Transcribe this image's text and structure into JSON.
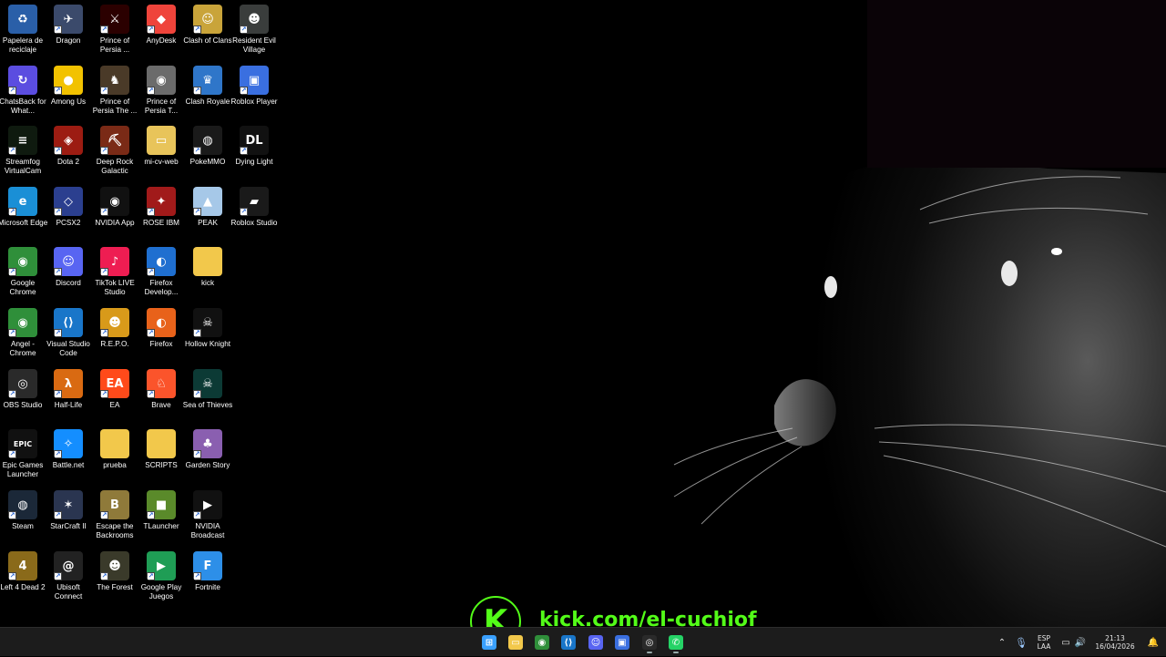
{
  "desktop": {
    "icons": [
      {
        "label": "Papelera de reciclaje",
        "icon": "recycle-bin-icon",
        "color": "#2a5fa8",
        "glyph": "♻",
        "shortcut": false
      },
      {
        "label": "Dragon",
        "icon": "dragon-icon",
        "color": "#3b4a6b",
        "glyph": "✈",
        "shortcut": true
      },
      {
        "label": "Prince of Persia ...",
        "icon": "prince-of-persia-icon",
        "color": "#2b0000",
        "glyph": "⚔",
        "shortcut": true
      },
      {
        "label": "AnyDesk",
        "icon": "anydesk-icon",
        "color": "#ef443b",
        "glyph": "◆",
        "shortcut": true
      },
      {
        "label": "Clash of Clans",
        "icon": "clash-of-clans-icon",
        "color": "#c9a43a",
        "glyph": "☺",
        "shortcut": true
      },
      {
        "label": "Resident Evil Village",
        "icon": "resident-evil-village-icon",
        "color": "#3a3d3c",
        "glyph": "☻",
        "shortcut": true
      },
      {
        "label": "ChatsBack for What...",
        "icon": "chatsback-icon",
        "color": "#5b4de0",
        "glyph": "↻",
        "shortcut": true
      },
      {
        "label": "Among Us",
        "icon": "among-us-icon",
        "color": "#f2c200",
        "glyph": "●",
        "shortcut": true
      },
      {
        "label": "Prince of Persia The ...",
        "icon": "prince-of-persia-sands-icon",
        "color": "#4a3a28",
        "glyph": "♞",
        "shortcut": true
      },
      {
        "label": "Prince of Persia T...",
        "icon": "prince-of-persia-t-icon",
        "color": "#6b6b6b",
        "glyph": "◉",
        "shortcut": true
      },
      {
        "label": "Clash Royale",
        "icon": "clash-royale-icon",
        "color": "#2f76c9",
        "glyph": "♛",
        "shortcut": true
      },
      {
        "label": "Roblox Player",
        "icon": "roblox-player-icon",
        "color": "#3a6fe0",
        "glyph": "▣",
        "shortcut": true
      },
      {
        "label": "Streamfog VirtualCam",
        "icon": "streamfog-icon",
        "color": "#0f1a0f",
        "glyph": "≡",
        "shortcut": true
      },
      {
        "label": "Dota 2",
        "icon": "dota2-icon",
        "color": "#9c1c12",
        "glyph": "◈",
        "shortcut": true
      },
      {
        "label": "Deep Rock Galactic",
        "icon": "deep-rock-galactic-icon",
        "color": "#7a2a16",
        "glyph": "⛏",
        "shortcut": true
      },
      {
        "label": "mi-cv-web",
        "icon": "folder-icon",
        "color": "#e8c45a",
        "glyph": "▭",
        "shortcut": false
      },
      {
        "label": "PokeMMO",
        "icon": "pokemmo-icon",
        "color": "#1a1a1a",
        "glyph": "◍",
        "shortcut": true
      },
      {
        "label": "Dying Light",
        "icon": "dying-light-icon",
        "color": "#111111",
        "glyph": "DL",
        "shortcut": true
      },
      {
        "label": "Microsoft Edge",
        "icon": "edge-icon",
        "color": "#1a8fd6",
        "glyph": "e",
        "shortcut": true
      },
      {
        "label": "PCSX2",
        "icon": "pcsx2-icon",
        "color": "#2b3f8f",
        "glyph": "◇",
        "shortcut": true
      },
      {
        "label": "NVIDIA App",
        "icon": "nvidia-app-icon",
        "color": "#111111",
        "glyph": "◉",
        "shortcut": true
      },
      {
        "label": "ROSE IBM",
        "icon": "rose-ibm-icon",
        "color": "#a11a1a",
        "glyph": "✦",
        "shortcut": true
      },
      {
        "label": "PEAK",
        "icon": "peak-icon",
        "color": "#a6c8e8",
        "glyph": "▲",
        "shortcut": true
      },
      {
        "label": "Roblox Studio",
        "icon": "roblox-studio-icon",
        "color": "#1a1a1a",
        "glyph": "▰",
        "shortcut": true
      },
      {
        "label": "Google Chrome",
        "icon": "chrome-icon",
        "color": "#2f8f3a",
        "glyph": "◉",
        "shortcut": true
      },
      {
        "label": "Discord",
        "icon": "discord-icon",
        "color": "#5865f2",
        "glyph": "☺",
        "shortcut": true
      },
      {
        "label": "TikTok LIVE Studio",
        "icon": "tiktok-live-icon",
        "color": "#ee1d52",
        "glyph": "♪",
        "shortcut": true
      },
      {
        "label": "Firefox Develop...",
        "icon": "firefox-developer-icon",
        "color": "#1f6fd0",
        "glyph": "◐",
        "shortcut": true
      },
      {
        "label": "kick",
        "icon": "folder-icon",
        "color": "#f2c84b",
        "glyph": "",
        "shortcut": false
      },
      {
        "label": "",
        "icon": "",
        "color": "",
        "glyph": "",
        "shortcut": false
      },
      {
        "label": "Angel - Chrome",
        "icon": "angel-chrome-icon",
        "color": "#2f8f3a",
        "glyph": "◉",
        "shortcut": true
      },
      {
        "label": "Visual Studio Code",
        "icon": "vscode-icon",
        "color": "#1976c9",
        "glyph": "⟨⟩",
        "shortcut": true
      },
      {
        "label": "R.E.P.O.",
        "icon": "repo-icon",
        "color": "#d89a1a",
        "glyph": "☻",
        "shortcut": true
      },
      {
        "label": "Firefox",
        "icon": "firefox-icon",
        "color": "#e8621a",
        "glyph": "◐",
        "shortcut": true
      },
      {
        "label": "Hollow Knight",
        "icon": "hollow-knight-icon",
        "color": "#111111",
        "glyph": "☠",
        "shortcut": true
      },
      {
        "label": "",
        "icon": "",
        "color": "",
        "glyph": "",
        "shortcut": false
      },
      {
        "label": "OBS Studio",
        "icon": "obs-studio-icon",
        "color": "#2a2a2a",
        "glyph": "◎",
        "shortcut": true
      },
      {
        "label": "Half-Life",
        "icon": "half-life-icon",
        "color": "#d96a12",
        "glyph": "λ",
        "shortcut": true
      },
      {
        "label": "EA",
        "icon": "ea-icon",
        "color": "#ff4a1a",
        "glyph": "EA",
        "shortcut": true
      },
      {
        "label": "Brave",
        "icon": "brave-icon",
        "color": "#fb542b",
        "glyph": "♘",
        "shortcut": true
      },
      {
        "label": "Sea of Thieves",
        "icon": "sea-of-thieves-icon",
        "color": "#0c3a35",
        "glyph": "☠",
        "shortcut": true
      },
      {
        "label": "",
        "icon": "",
        "color": "",
        "glyph": "",
        "shortcut": false
      },
      {
        "label": "Epic Games Launcher",
        "icon": "epic-games-icon",
        "color": "#111111",
        "glyph": "EPIC",
        "shortcut": true
      },
      {
        "label": "Battle.net",
        "icon": "battlenet-icon",
        "color": "#148eff",
        "glyph": "✧",
        "shortcut": true
      },
      {
        "label": "prueba",
        "icon": "folder-icon",
        "color": "#f2c84b",
        "glyph": "",
        "shortcut": false
      },
      {
        "label": "SCRIPTS",
        "icon": "folder-icon",
        "color": "#f2c84b",
        "glyph": "",
        "shortcut": false
      },
      {
        "label": "Garden Story",
        "icon": "garden-story-icon",
        "color": "#8a5fb0",
        "glyph": "♣",
        "shortcut": true
      },
      {
        "label": "",
        "icon": "",
        "color": "",
        "glyph": "",
        "shortcut": false
      },
      {
        "label": "Steam",
        "icon": "steam-icon",
        "color": "#1b2838",
        "glyph": "◍",
        "shortcut": true
      },
      {
        "label": "StarCraft II",
        "icon": "starcraft2-icon",
        "color": "#2a3550",
        "glyph": "✶",
        "shortcut": true
      },
      {
        "label": "Escape the Backrooms",
        "icon": "escape-backrooms-icon",
        "color": "#8f7a3a",
        "glyph": "B",
        "shortcut": true
      },
      {
        "label": "TLauncher",
        "icon": "tlauncher-icon",
        "color": "#5a8a2a",
        "glyph": "■",
        "shortcut": true
      },
      {
        "label": "NVIDIA Broadcast",
        "icon": "nvidia-broadcast-icon",
        "color": "#111111",
        "glyph": "▶",
        "shortcut": true
      },
      {
        "label": "",
        "icon": "",
        "color": "",
        "glyph": "",
        "shortcut": false
      },
      {
        "label": "Left 4 Dead 2",
        "icon": "left4dead2-icon",
        "color": "#8a6a1a",
        "glyph": "4",
        "shortcut": true
      },
      {
        "label": "Ubisoft Connect",
        "icon": "ubisoft-connect-icon",
        "color": "#222222",
        "glyph": "@",
        "shortcut": true
      },
      {
        "label": "The Forest",
        "icon": "the-forest-icon",
        "color": "#3a3a2a",
        "glyph": "☻",
        "shortcut": true
      },
      {
        "label": "Google Play Juegos",
        "icon": "google-play-games-icon",
        "color": "#1f9d55",
        "glyph": "▶",
        "shortcut": true
      },
      {
        "label": "Fortnite",
        "icon": "fortnite-icon",
        "color": "#2d8fe8",
        "glyph": "F",
        "shortcut": true
      }
    ]
  },
  "overlay": {
    "kick_letter": "K",
    "kick_url": "kick.com/el-cuchiof",
    "accent": "#53fc18"
  },
  "taskbar": {
    "apps": [
      {
        "name": "start-button",
        "icon": "windows-start-icon",
        "color": "#3aa0ff",
        "glyph": "⊞"
      },
      {
        "name": "file-explorer",
        "icon": "file-explorer-icon",
        "color": "#f2c84b",
        "glyph": "▭"
      },
      {
        "name": "chrome",
        "icon": "chrome-icon",
        "color": "#2f8f3a",
        "glyph": "◉"
      },
      {
        "name": "vscode",
        "icon": "vscode-icon",
        "color": "#1976c9",
        "glyph": "⟨⟩"
      },
      {
        "name": "discord",
        "icon": "discord-icon",
        "color": "#5865f2",
        "glyph": "☺"
      },
      {
        "name": "roblox",
        "icon": "roblox-icon",
        "color": "#3a6fe0",
        "glyph": "▣"
      },
      {
        "name": "obs",
        "icon": "obs-studio-icon",
        "color": "#2a2a2a",
        "glyph": "◎"
      },
      {
        "name": "whatsapp",
        "icon": "whatsapp-icon",
        "color": "#25d366",
        "glyph": "✆"
      }
    ],
    "tray": {
      "lang_line1": "ESP",
      "lang_line2": "LAA",
      "time": "21:13",
      "date": "16/04/2026"
    }
  }
}
